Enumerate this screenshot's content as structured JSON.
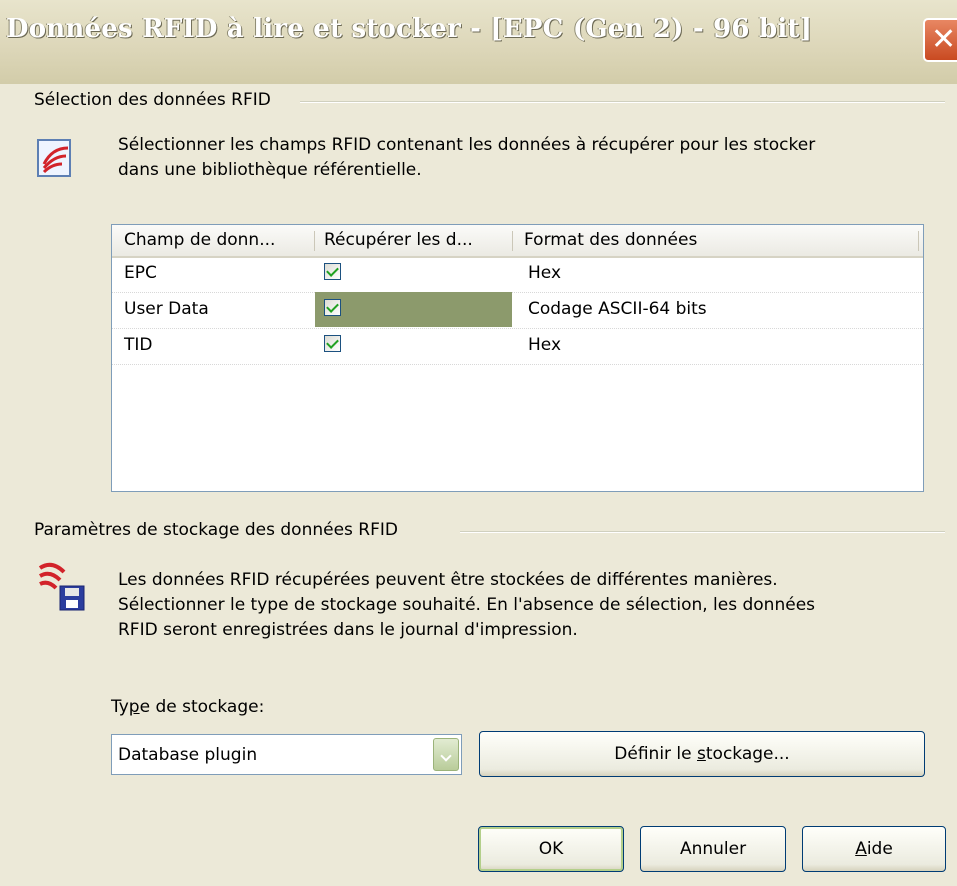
{
  "window": {
    "title": "Données RFID à lire et stocker - [EPC (Gen 2) - 96 bit]",
    "close_glyph": "✕"
  },
  "selection_group": {
    "label": "Sélection des données RFID",
    "description_line1": "Sélectionner les champs RFID contenant les données à récupérer pour les stocker",
    "description_line2": "dans une bibliothèque référentielle.",
    "icon": "rfid-signal-document-icon"
  },
  "table": {
    "columns": [
      "Champ de donn...",
      "Récupérer les d...",
      "Format des données"
    ],
    "rows": [
      {
        "field": "EPC",
        "retrieve": true,
        "format": "Hex"
      },
      {
        "field": "User Data",
        "retrieve": true,
        "format": "Codage ASCII-64 bits"
      },
      {
        "field": "TID",
        "retrieve": true,
        "format": "Hex"
      }
    ]
  },
  "storage_group": {
    "label": "Paramètres de stockage des données RFID",
    "description_line1": "Les données RFID récupérées peuvent être stockées de différentes manières.",
    "description_line2": "Sélectionner le type de stockage souhaité. En l'absence de sélection, les données",
    "description_line3": "RFID seront enregistrées dans le journal d'impression.",
    "icon": "rfid-signal-floppy-icon"
  },
  "storage": {
    "type_label_prefix": "Ty",
    "type_label_mnemonic": "p",
    "type_label_suffix": "e de stockage:",
    "type_value": "Database plugin",
    "define_prefix": "Définir le ",
    "define_mnemonic": "s",
    "define_suffix": "tockage..."
  },
  "buttons": {
    "ok": "OK",
    "cancel": "Annuler",
    "help_mnemonic": "A",
    "help_suffix": "ide"
  },
  "colors": {
    "selected_cell": "#8c9a6c",
    "dialog_bg": "#ece9d8",
    "close_button": "#d7542b"
  }
}
